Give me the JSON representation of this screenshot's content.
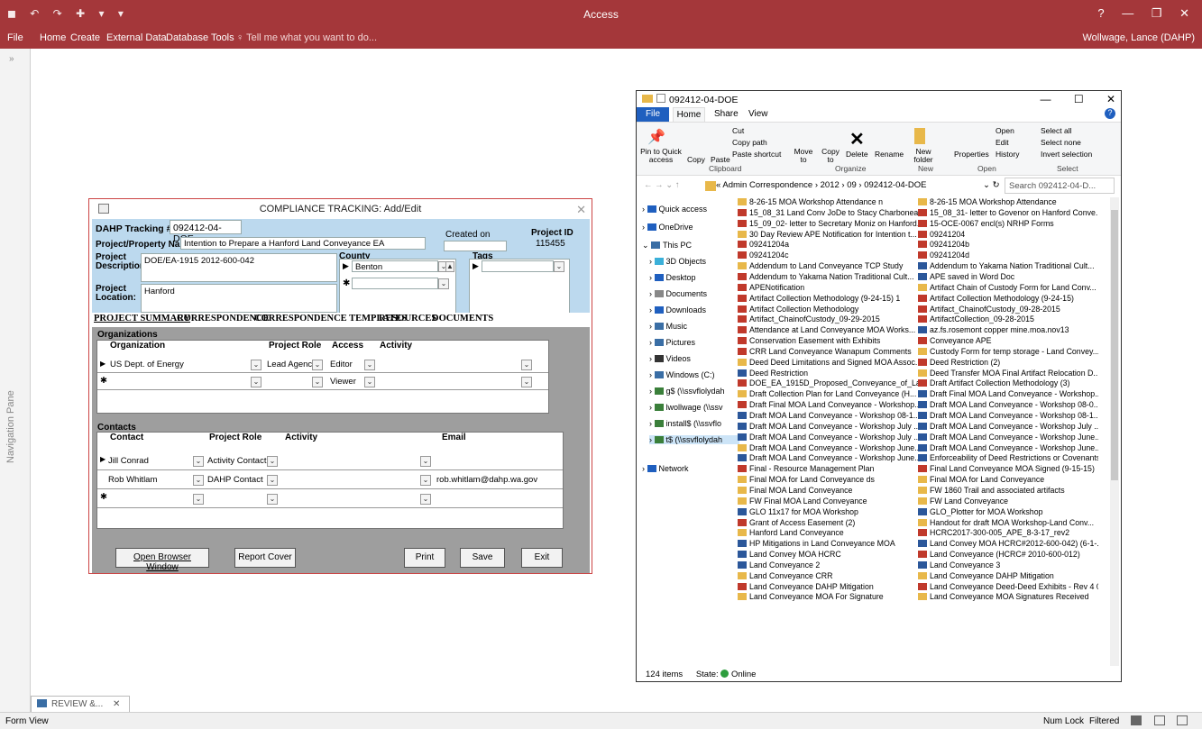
{
  "access": {
    "title": "Access",
    "qat": "◼ ↶ ↷ ✚ ▾ ▾",
    "user": "Wollwage, Lance (DAHP)",
    "menu": [
      "File",
      "Home",
      "Create",
      "External Data",
      "Database Tools",
      "♀ Tell me what you want to do..."
    ],
    "nav_label": "Navigation Pane",
    "doc_tab": "REVIEW &...",
    "status_left": "Form View",
    "status_right": [
      "Num Lock",
      "Filtered"
    ]
  },
  "form": {
    "title": "COMPLIANCE TRACKING: Add/Edit",
    "tracking_label": "DAHP Tracking #:",
    "tracking_value": "092412-04-DOE",
    "created_label": "Created on",
    "projectid_label": "Project ID",
    "projectid_value": "115455",
    "name_label": "Project/Property Name:",
    "name_value": "Intention to Prepare a Hanford Land Conveyance EA",
    "county_label": "County",
    "county_value": "Benton",
    "tags_label": "Tags",
    "desc_label": "Project Description:",
    "desc_value": "DOE/EA-1915  2012-600-042",
    "loc_label": "Project Location:",
    "loc_value": "Hanford",
    "tabs": [
      "PROJECT SUMMARY",
      "CORRESPONDENCE",
      "CORRESPONDENCE TEMPLATES",
      "RESOURCES",
      "DOCUMENTS"
    ],
    "org_title": "Organizations",
    "org_cols": [
      "Organization",
      "Project Role",
      "Access",
      "Activity"
    ],
    "org_rows": [
      {
        "org": "US Dept. of Energy",
        "role": "Lead Agency",
        "access": "Editor"
      },
      {
        "org": "",
        "role": "",
        "access": "Viewer"
      }
    ],
    "contacts_title": "Contacts",
    "contact_cols": [
      "Contact",
      "Project Role",
      "Activity",
      "Email"
    ],
    "contact_rows": [
      {
        "contact": "Jill Conrad",
        "role": "Activity Contact",
        "email": ""
      },
      {
        "contact": "Rob Whitlam",
        "role": "DAHP Contact",
        "email": "rob.whitlam@dahp.wa.gov"
      },
      {
        "contact": "",
        "role": "",
        "email": ""
      }
    ],
    "buttons": {
      "browser": "Open Browser Window",
      "report": "Report Cover",
      "print": "Print",
      "save": "Save",
      "exit": "Exit"
    }
  },
  "explorer": {
    "title": "092412-04-DOE",
    "tabs": [
      "File",
      "Home",
      "Share",
      "View"
    ],
    "ribbon": {
      "pin": "Pin to Quick access",
      "copy": "Copy",
      "paste": "Paste",
      "cut": "Cut",
      "copypath": "Copy path",
      "pasteshortcut": "Paste shortcut",
      "move": "Move to",
      "copyto": "Copy to",
      "delete": "Delete",
      "rename": "Rename",
      "newfolder": "New folder",
      "properties": "Properties",
      "open": "Open",
      "edit": "Edit",
      "history": "History",
      "selectall": "Select all",
      "selectnone": "Select none",
      "invert": "Invert selection",
      "groups": [
        "Clipboard",
        "Organize",
        "New",
        "Open",
        "Select"
      ]
    },
    "address": "« Admin Correspondence › 2012 › 09 › 092412-04-DOE",
    "search": "Search 092412-04-D...",
    "tree": [
      "Quick access",
      "OneDrive",
      "This PC",
      "3D Objects",
      "Desktop",
      "Documents",
      "Downloads",
      "Music",
      "Pictures",
      "Videos",
      "Windows (C:)",
      "g$ (\\\\ssvflolydah",
      "lwollwage (\\\\ssv",
      "install$ (\\\\ssvflo",
      "t$ (\\\\ssvflolydah",
      "Network"
    ],
    "files": [
      [
        "8-26-15 MOA Workshop Attendance n",
        "m"
      ],
      [
        "8-26-15 MOA Workshop Attendance",
        "m"
      ],
      [
        "15_08_31 Land Conv JoDe to Stacy Charboneau...",
        "p"
      ],
      [
        "15_08_31- letter to Govenor on Hanford Conve...",
        "p"
      ],
      [
        "15_09_02- letter to Secretary Moniz on Hanford...",
        "p"
      ],
      [
        "15-OCE-0067 encl(s) NRHP Forms",
        "p"
      ],
      [
        "30 Day Review APE Notification for Intention t...",
        "m"
      ],
      [
        "09241204",
        "p"
      ],
      [
        "09241204a",
        "p"
      ],
      [
        "09241204b",
        "p"
      ],
      [
        "09241204c",
        "p"
      ],
      [
        "09241204d",
        "p"
      ],
      [
        "Addendum to Land Conveyance TCP Study",
        "m"
      ],
      [
        "Addendum to Yakama Nation Traditional Cult...",
        "w"
      ],
      [
        "Addendum to Yakama Nation Traditional Cult...",
        "p"
      ],
      [
        "APE saved in Word Doc",
        "w"
      ],
      [
        "APENotification",
        "p"
      ],
      [
        "Artifact Chain of Custody Form for Land Conv...",
        "m"
      ],
      [
        "Artifact Collection Methodology (9-24-15) 1",
        "p"
      ],
      [
        "Artifact Collection Methodology (9-24-15)",
        "p"
      ],
      [
        "Artifact Collection Methodology",
        "p"
      ],
      [
        "Artifact_ChainofCustody_09-28-2015",
        "p"
      ],
      [
        "Artifact_ChainofCustody_09-29-2015",
        "p"
      ],
      [
        "ArtifactCollection_09-28-2015",
        "p"
      ],
      [
        "Attendance at Land  Conveyance MOA Works...",
        "p"
      ],
      [
        "az.fs.rosemont copper mine.moa.nov13",
        "w"
      ],
      [
        "Conservation Easement with Exhibits",
        "p"
      ],
      [
        "Conveyance APE",
        "p"
      ],
      [
        "CRR Land Conveyance Wanapum Comments",
        "p"
      ],
      [
        "Custody Form for temp storage - Land Convey...",
        "m"
      ],
      [
        "Deed Deed Limitations and Signed MOA Assoc...",
        "m"
      ],
      [
        "Deed Restriction (2)",
        "p"
      ],
      [
        "Deed Restriction",
        "w"
      ],
      [
        "Deed Transfer MOA Final Artifact Relocation D...",
        "m"
      ],
      [
        "DOE_EA_1915D_Proposed_Conveyance_of_Lan...",
        "p"
      ],
      [
        "Draft Artifact Collection Methodology (3)",
        "p"
      ],
      [
        "Draft Collection Plan for Land Conveyance (H...",
        "m"
      ],
      [
        "Draft Final MOA Land Conveyance - Workshop...",
        "w"
      ],
      [
        "Draft Final MOA Land Conveyance - Workshop...",
        "p"
      ],
      [
        "Draft MOA Land Conveyance - Workshop 08-0...",
        "w"
      ],
      [
        "Draft MOA Land Conveyance - Workshop 08-1...",
        "w"
      ],
      [
        "Draft MOA Land Conveyance - Workshop 08-1...",
        "w"
      ],
      [
        "Draft MOA Land Conveyance - Workshop July ...",
        "w"
      ],
      [
        "Draft MOA Land Conveyance - Workshop July ...",
        "w"
      ],
      [
        "Draft MOA Land Conveyance - Workshop July ...",
        "w"
      ],
      [
        "Draft MOA Land Conveyance - Workshop June...",
        "w"
      ],
      [
        "Draft MOA Land Conveyance - Workshop June...",
        "m"
      ],
      [
        "Draft MOA Land Conveyance - Workshop June...",
        "w"
      ],
      [
        "Draft MOA Land Conveyance - Workshop June...",
        "w"
      ],
      [
        "Enforceability of Deed Restrictions or Covenants",
        "w"
      ],
      [
        "Final - Resource Management Plan",
        "p"
      ],
      [
        "Final Land Conveyance MOA Signed (9-15-15)",
        "p"
      ],
      [
        "Final MOA for Land Conveyance ds",
        "m"
      ],
      [
        "Final MOA for Land Conveyance",
        "m"
      ],
      [
        "Final MOA Land Conveyance",
        "m"
      ],
      [
        "FW 1860 Trail and associated artifacts",
        "m"
      ],
      [
        "FW Final MOA Land Conveyance",
        "m"
      ],
      [
        "FW Land Conveyance",
        "m"
      ],
      [
        "GLO 11x17 for MOA Workshop",
        "i"
      ],
      [
        "GLO_Plotter for MOA Workshop",
        "i"
      ],
      [
        "Grant of Access Easement (2)",
        "p"
      ],
      [
        "Handout for draft MOA Workshop-Land Conv...",
        "m"
      ],
      [
        "Hanford Land Conveyance",
        "m"
      ],
      [
        "HCRC2017-300-005_APE_8-3-17_rev2",
        "p"
      ],
      [
        "HP Mitigations in Land Conveyance MOA",
        "w"
      ],
      [
        "Land Convey MOA HCRC#2012-600-042) (6-1-...",
        "w"
      ],
      [
        "Land Convey MOA HCRC",
        "w"
      ],
      [
        "Land Conveyance (HCRC# 2010-600-012)",
        "p"
      ],
      [
        "Land Conveyance 2",
        "w"
      ],
      [
        "Land Conveyance 3",
        "w"
      ],
      [
        "Land Conveyance CRR",
        "m"
      ],
      [
        "Land Conveyance DAHP Mitigation",
        "m"
      ],
      [
        "Land Conveyance DAHP Mitigation",
        "p"
      ],
      [
        "Land Conveyance Deed-Deed Exhibits - Rev 4 0...",
        "p"
      ],
      [
        "Land Conveyance MOA For Signature",
        "m"
      ],
      [
        "Land Conveyance MOA Signatures Received",
        "m"
      ]
    ],
    "status_items": "124 items",
    "status_state": "State:",
    "status_online": "Online"
  },
  "colors": {
    "access_red": "#a4373a",
    "form_header": "#bcd9ee",
    "form_gray": "#9e9e9e",
    "pdf": "#c0392b",
    "mail": "#e8b84a",
    "word": "#2b579a"
  }
}
